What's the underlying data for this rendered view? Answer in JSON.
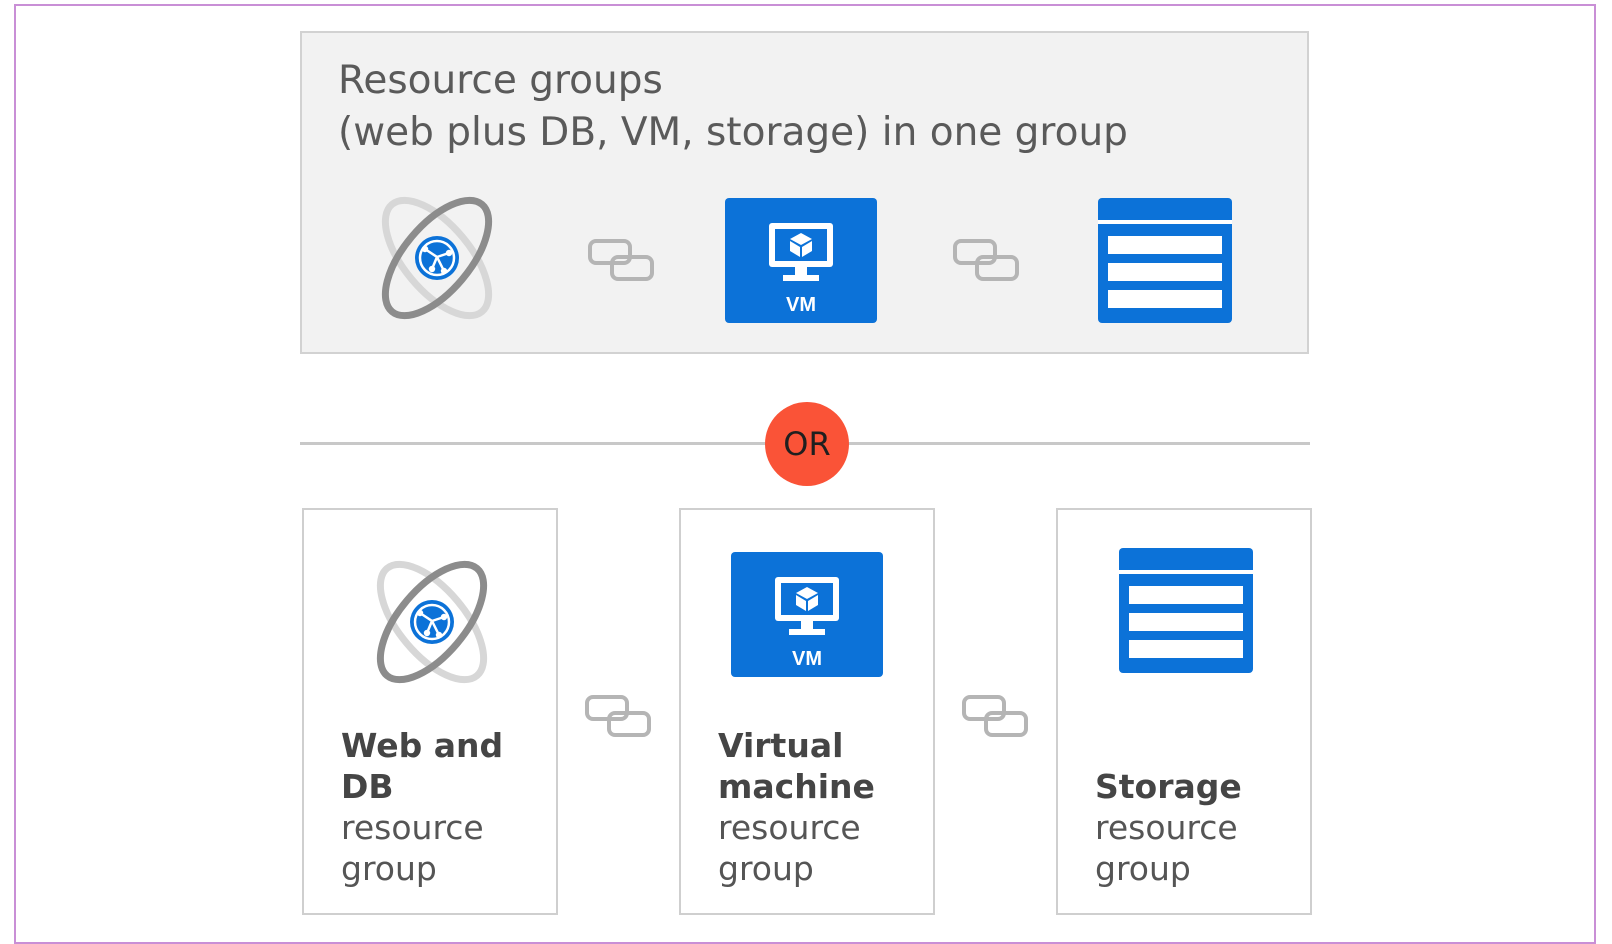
{
  "top_group": {
    "title_line1": "Resource groups",
    "title_line2": "(web plus DB, VM, storage) in one group",
    "vm_label": "VM"
  },
  "separator": {
    "or_label": "OR"
  },
  "resource_groups": [
    {
      "bold_line1": "Web and",
      "bold_line2": "DB",
      "light_line1": "resource",
      "light_line2": "group",
      "icon": "web-app-icon"
    },
    {
      "bold_line1": "Virtual",
      "bold_line2": "machine",
      "light_line1": "resource",
      "light_line2": "group",
      "icon": "virtual-machine-icon",
      "vm_label": "VM"
    },
    {
      "bold_line1": "Storage",
      "light_line1": "resource",
      "light_line2": "group",
      "icon": "storage-icon"
    }
  ],
  "colors": {
    "frame_border": "#c98fd6",
    "panel_background": "#f2f2f2",
    "azure_blue": "#0c72d8",
    "or_badge": "#fa5337",
    "link_icon": "#b5b5b5"
  }
}
